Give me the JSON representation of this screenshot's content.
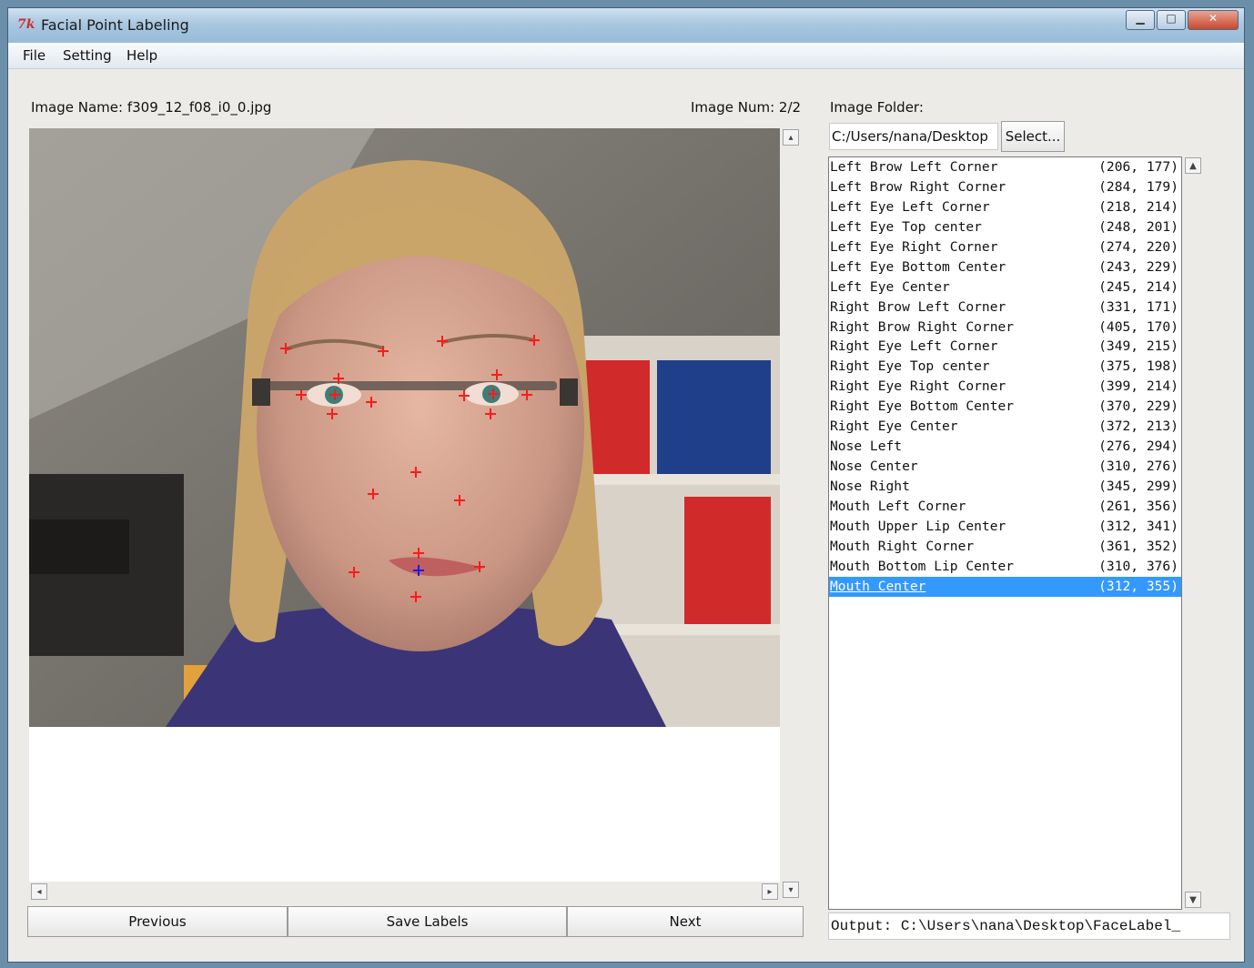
{
  "window": {
    "title": "Facial Point Labeling",
    "icon": "tk-icon"
  },
  "menu": [
    "File",
    "Setting",
    "Help"
  ],
  "image_name_label": "Image Name: f309_12_f08_i0_0.jpg",
  "image_num_label": "Image Num: 2/2",
  "folder": {
    "label": "Image Folder:",
    "value": "C:/Users/nana/Desktop",
    "select_label": "Select..."
  },
  "buttons": {
    "previous": "Previous",
    "save": "Save Labels",
    "next": "Next"
  },
  "points": [
    {
      "name": "Left Brow Left Corner",
      "coord": "(206, 177)"
    },
    {
      "name": "Left Brow Right Corner",
      "coord": "(284, 179)"
    },
    {
      "name": "Left Eye Left Corner",
      "coord": "(218, 214)"
    },
    {
      "name": "Left Eye Top center",
      "coord": "(248, 201)"
    },
    {
      "name": "Left Eye Right Corner",
      "coord": "(274, 220)"
    },
    {
      "name": "Left Eye Bottom Center",
      "coord": "(243, 229)"
    },
    {
      "name": "Left Eye Center",
      "coord": "(245, 214)"
    },
    {
      "name": "Right Brow Left Corner",
      "coord": "(331, 171)"
    },
    {
      "name": "Right Brow Right Corner",
      "coord": "(405, 170)"
    },
    {
      "name": "Right Eye Left Corner",
      "coord": "(349, 215)"
    },
    {
      "name": "Right Eye Top center",
      "coord": "(375, 198)"
    },
    {
      "name": "Right Eye Right Corner",
      "coord": "(399, 214)"
    },
    {
      "name": "Right Eye Bottom Center",
      "coord": "(370, 229)"
    },
    {
      "name": "Right Eye Center",
      "coord": "(372, 213)"
    },
    {
      "name": "Nose Left",
      "coord": "(276, 294)"
    },
    {
      "name": "Nose Center",
      "coord": "(310, 276)"
    },
    {
      "name": "Nose Right",
      "coord": "(345, 299)"
    },
    {
      "name": "Mouth Left Corner",
      "coord": "(261, 356)"
    },
    {
      "name": "Mouth Upper Lip Center",
      "coord": "(312, 341)"
    },
    {
      "name": "Mouth Right Corner",
      "coord": "(361, 352)"
    },
    {
      "name": "Mouth Bottom Lip Center",
      "coord": "(310, 376)"
    },
    {
      "name": "Mouth Center",
      "coord": "(312, 355)"
    }
  ],
  "selected_index": 21,
  "output": "Output: C:\\Users\\nana\\Desktop\\FaceLabel_",
  "colors": {
    "marker": "#ff1a1a",
    "selected_marker": "#1a1aff",
    "selection": "#3399ff"
  }
}
